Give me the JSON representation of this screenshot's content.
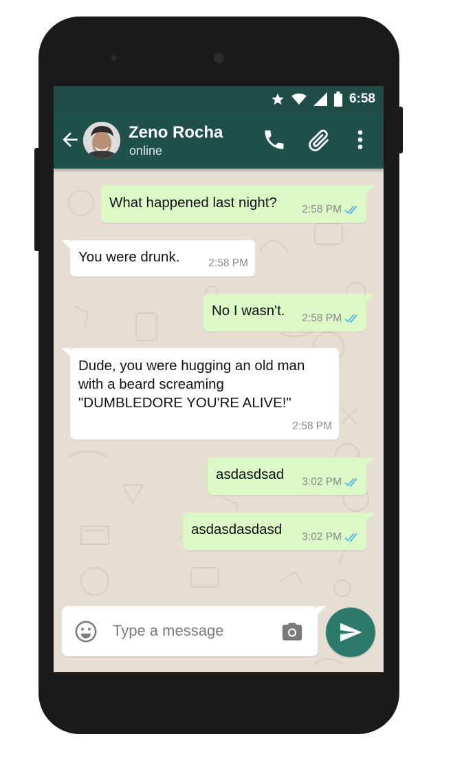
{
  "status_bar": {
    "time": "6:58",
    "icons": [
      "star-icon",
      "wifi-icon",
      "signal-icon",
      "battery-icon"
    ]
  },
  "header": {
    "contact_name": "Zeno Rocha",
    "contact_status": "online",
    "icons": [
      "back-arrow-icon",
      "avatar",
      "phone-icon",
      "paperclip-icon",
      "more-vert-icon"
    ]
  },
  "messages": [
    {
      "direction": "outgoing",
      "text": "What happened last night?",
      "time": "2:58 PM",
      "read": true
    },
    {
      "direction": "incoming",
      "text": "You were drunk.",
      "time": "2:58 PM"
    },
    {
      "direction": "outgoing",
      "text": "No I wasn't.",
      "time": "2:58 PM",
      "read": true
    },
    {
      "direction": "incoming",
      "text": "Dude, you were hugging an old man\nwith a beard screaming\n\"DUMBLEDORE YOU'RE ALIVE!\"",
      "time": "2:58 PM"
    },
    {
      "direction": "outgoing",
      "text": "asdasdsad",
      "time": "3:02 PM",
      "read": true
    },
    {
      "direction": "outgoing",
      "text": "asdasdasdasd",
      "time": "3:02 PM",
      "read": true
    }
  ],
  "composer": {
    "placeholder": "Type a message",
    "icons": [
      "emoji-icon",
      "camera-icon",
      "send-icon"
    ]
  },
  "colors": {
    "header": "#1f5049",
    "status_bar": "#1f4c45",
    "outgoing_bubble": "#dcf8c6",
    "incoming_bubble": "#ffffff",
    "chat_background": "#e6ded3",
    "send_button": "#2b7a6c",
    "read_ticks": "#4fb6ec"
  }
}
